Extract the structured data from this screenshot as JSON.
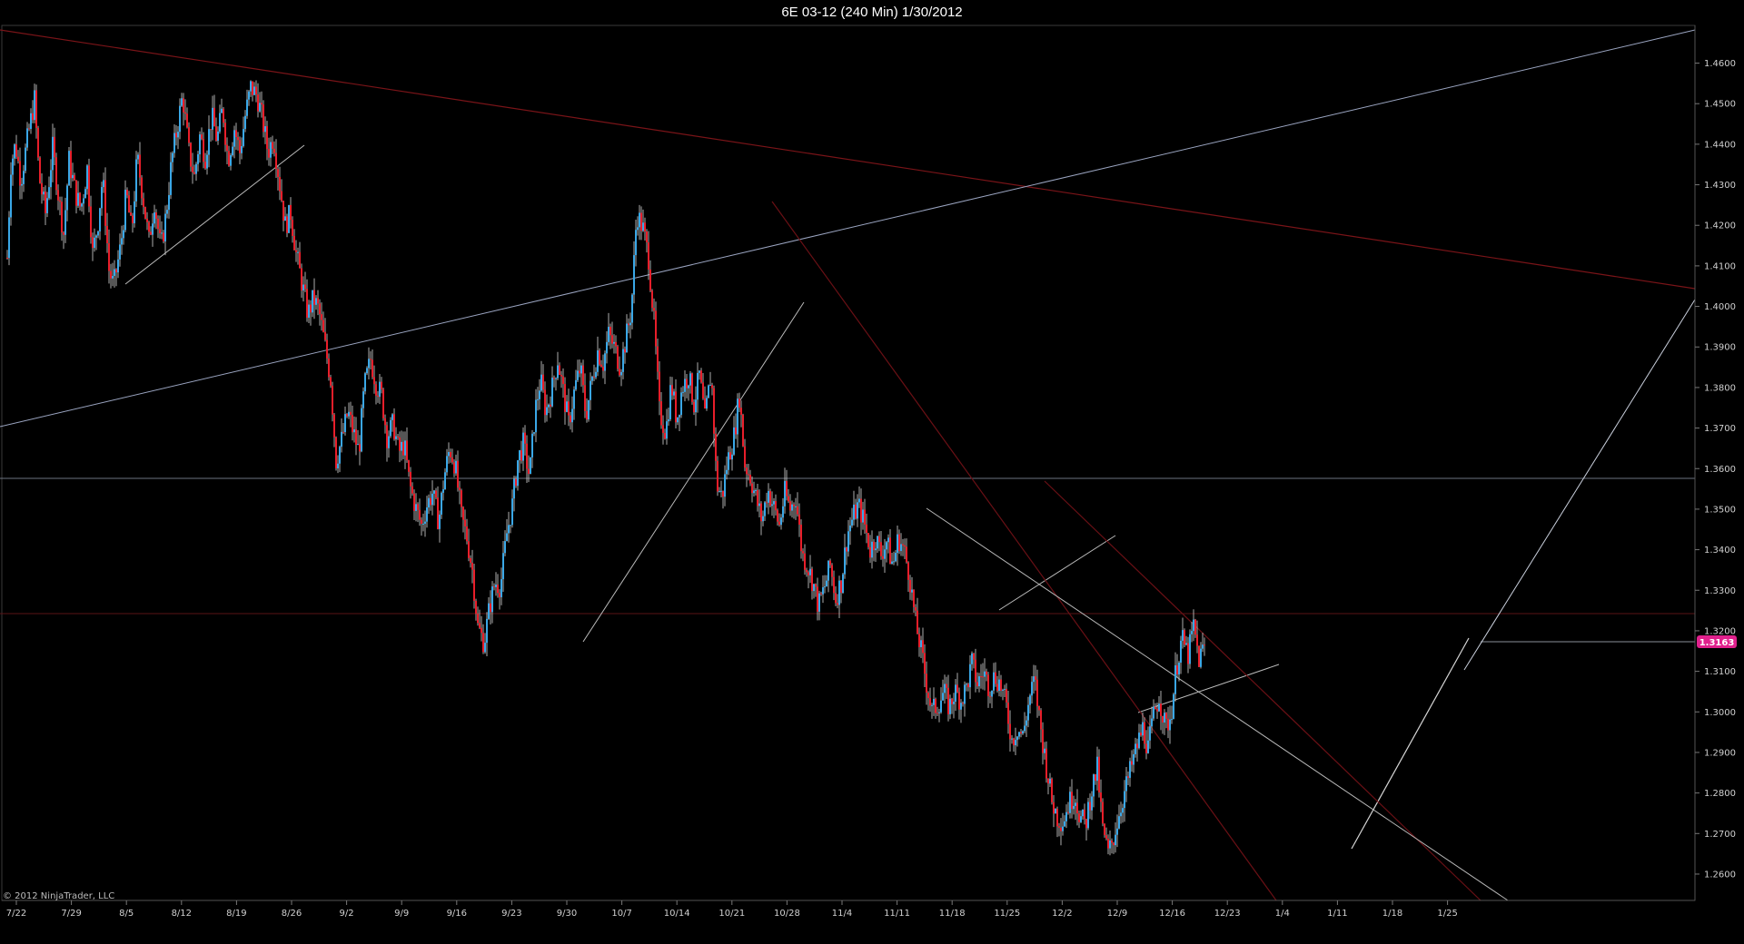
{
  "window": {
    "title": "6E 03-12 (240 Min)  1/30/2012"
  },
  "copyright": "© 2012 NinjaTrader, LLC",
  "colors": {
    "background": "#000000",
    "up_candle": "#3aa7e6",
    "down_candle": "#e81e2a",
    "wick": "#d8d8d8",
    "price_marker": "#e0208c",
    "axis": "#555555",
    "support_line": "#cfd6e8",
    "resistance_line": "#7a1418",
    "horizontal_level": "#8a9099"
  },
  "chart_data": {
    "type": "candlestick",
    "instrument": "6E 03-12",
    "timeframe": "240 Min",
    "date": "1/30/2012",
    "last_price": "1.3163",
    "ylim": [
      1.2535,
      1.4693
    ],
    "x_tick_labels": [
      "7/22",
      "7/29",
      "8/5",
      "8/12",
      "8/19",
      "8/26",
      "9/2",
      "9/9",
      "9/16",
      "9/23",
      "9/30",
      "10/7",
      "10/14",
      "10/21",
      "10/28",
      "11/4",
      "11/11",
      "11/18",
      "11/25",
      "12/2",
      "12/9",
      "12/16",
      "12/23",
      "1/4",
      "1/11",
      "1/18",
      "1/25"
    ],
    "y_tick_labels": [
      "1.4600",
      "1.4500",
      "1.4400",
      "1.4300",
      "1.4200",
      "1.4100",
      "1.4000",
      "1.3900",
      "1.3800",
      "1.3700",
      "1.3600",
      "1.3500",
      "1.3400",
      "1.3300",
      "1.3200",
      "1.3100",
      "1.3000",
      "1.2900",
      "1.2800",
      "1.2700",
      "1.2600"
    ],
    "price_path": [
      [
        0,
        1.412
      ],
      [
        4,
        1.435
      ],
      [
        9,
        1.44
      ],
      [
        15,
        1.431
      ],
      [
        22,
        1.441
      ],
      [
        30,
        1.451
      ],
      [
        35,
        1.432
      ],
      [
        42,
        1.423
      ],
      [
        50,
        1.439
      ],
      [
        57,
        1.426
      ],
      [
        62,
        1.418
      ],
      [
        68,
        1.436
      ],
      [
        75,
        1.428
      ],
      [
        81,
        1.424
      ],
      [
        88,
        1.434
      ],
      [
        94,
        1.413
      ],
      [
        100,
        1.421
      ],
      [
        105,
        1.432
      ],
      [
        112,
        1.409
      ],
      [
        117,
        1.405
      ],
      [
        125,
        1.415
      ],
      [
        131,
        1.428
      ],
      [
        137,
        1.418
      ],
      [
        143,
        1.437
      ],
      [
        150,
        1.426
      ],
      [
        156,
        1.416
      ],
      [
        162,
        1.426
      ],
      [
        169,
        1.414
      ],
      [
        175,
        1.423
      ],
      [
        181,
        1.436
      ],
      [
        187,
        1.444
      ],
      [
        193,
        1.452
      ],
      [
        200,
        1.438
      ],
      [
        206,
        1.432
      ],
      [
        212,
        1.442
      ],
      [
        218,
        1.437
      ],
      [
        225,
        1.447
      ],
      [
        231,
        1.441
      ],
      [
        237,
        1.449
      ],
      [
        243,
        1.436
      ],
      [
        250,
        1.444
      ],
      [
        256,
        1.438
      ],
      [
        262,
        1.447
      ],
      [
        268,
        1.454
      ],
      [
        275,
        1.452
      ],
      [
        281,
        1.446
      ],
      [
        287,
        1.438
      ],
      [
        293,
        1.442
      ],
      [
        300,
        1.43
      ],
      [
        306,
        1.42
      ],
      [
        312,
        1.423
      ],
      [
        318,
        1.413
      ],
      [
        325,
        1.405
      ],
      [
        331,
        1.398
      ],
      [
        337,
        1.402
      ],
      [
        343,
        1.399
      ],
      [
        350,
        1.39
      ],
      [
        356,
        1.382
      ],
      [
        362,
        1.362
      ],
      [
        368,
        1.367
      ],
      [
        375,
        1.374
      ],
      [
        381,
        1.369
      ],
      [
        387,
        1.364
      ],
      [
        393,
        1.38
      ],
      [
        400,
        1.387
      ],
      [
        406,
        1.381
      ],
      [
        412,
        1.378
      ],
      [
        418,
        1.368
      ],
      [
        425,
        1.371
      ],
      [
        431,
        1.364
      ],
      [
        437,
        1.366
      ],
      [
        443,
        1.356
      ],
      [
        450,
        1.35
      ],
      [
        456,
        1.346
      ],
      [
        462,
        1.351
      ],
      [
        468,
        1.354
      ],
      [
        475,
        1.347
      ],
      [
        481,
        1.358
      ],
      [
        487,
        1.365
      ],
      [
        493,
        1.361
      ],
      [
        500,
        1.348
      ],
      [
        506,
        1.343
      ],
      [
        512,
        1.335
      ],
      [
        518,
        1.321
      ],
      [
        525,
        1.317
      ],
      [
        531,
        1.326
      ],
      [
        537,
        1.332
      ],
      [
        543,
        1.331
      ],
      [
        550,
        1.344
      ],
      [
        556,
        1.351
      ],
      [
        562,
        1.362
      ],
      [
        568,
        1.366
      ],
      [
        575,
        1.358
      ],
      [
        581,
        1.374
      ],
      [
        587,
        1.382
      ],
      [
        593,
        1.374
      ],
      [
        600,
        1.38
      ],
      [
        606,
        1.387
      ],
      [
        612,
        1.379
      ],
      [
        618,
        1.371
      ],
      [
        625,
        1.38
      ],
      [
        631,
        1.385
      ],
      [
        637,
        1.373
      ],
      [
        643,
        1.381
      ],
      [
        650,
        1.389
      ],
      [
        656,
        1.386
      ],
      [
        662,
        1.393
      ],
      [
        668,
        1.39
      ],
      [
        675,
        1.385
      ],
      [
        681,
        1.392
      ],
      [
        687,
        1.399
      ],
      [
        693,
        1.423
      ],
      [
        700,
        1.419
      ],
      [
        706,
        1.412
      ],
      [
        712,
        1.396
      ],
      [
        718,
        1.374
      ],
      [
        725,
        1.369
      ],
      [
        731,
        1.381
      ],
      [
        737,
        1.372
      ],
      [
        743,
        1.38
      ],
      [
        750,
        1.383
      ],
      [
        756,
        1.376
      ],
      [
        762,
        1.383
      ],
      [
        768,
        1.372
      ],
      [
        775,
        1.384
      ],
      [
        781,
        1.356
      ],
      [
        787,
        1.353
      ],
      [
        793,
        1.362
      ],
      [
        800,
        1.368
      ],
      [
        806,
        1.378
      ],
      [
        812,
        1.361
      ],
      [
        818,
        1.358
      ],
      [
        825,
        1.352
      ],
      [
        831,
        1.347
      ],
      [
        837,
        1.355
      ],
      [
        843,
        1.351
      ],
      [
        850,
        1.346
      ],
      [
        856,
        1.354
      ],
      [
        862,
        1.35
      ],
      [
        868,
        1.353
      ],
      [
        875,
        1.339
      ],
      [
        881,
        1.336
      ],
      [
        887,
        1.332
      ],
      [
        893,
        1.326
      ],
      [
        900,
        1.331
      ],
      [
        906,
        1.336
      ],
      [
        912,
        1.328
      ],
      [
        918,
        1.332
      ],
      [
        925,
        1.344
      ],
      [
        931,
        1.348
      ],
      [
        937,
        1.351
      ],
      [
        943,
        1.347
      ],
      [
        950,
        1.34
      ],
      [
        956,
        1.343
      ],
      [
        962,
        1.339
      ],
      [
        968,
        1.342
      ],
      [
        975,
        1.336
      ],
      [
        981,
        1.343
      ],
      [
        987,
        1.34
      ],
      [
        993,
        1.334
      ],
      [
        1000,
        1.322
      ],
      [
        1006,
        1.315
      ],
      [
        1012,
        1.307
      ],
      [
        1018,
        1.3
      ],
      [
        1025,
        1.302
      ],
      [
        1031,
        1.305
      ],
      [
        1037,
        1.301
      ],
      [
        1043,
        1.305
      ],
      [
        1050,
        1.303
      ],
      [
        1056,
        1.306
      ],
      [
        1062,
        1.312
      ],
      [
        1068,
        1.307
      ],
      [
        1075,
        1.31
      ],
      [
        1081,
        1.306
      ],
      [
        1087,
        1.309
      ],
      [
        1093,
        1.307
      ],
      [
        1100,
        1.301
      ],
      [
        1106,
        1.293
      ],
      [
        1112,
        1.296
      ],
      [
        1118,
        1.294
      ],
      [
        1125,
        1.303
      ],
      [
        1131,
        1.308
      ],
      [
        1137,
        1.297
      ],
      [
        1143,
        1.288
      ],
      [
        1150,
        1.278
      ],
      [
        1156,
        1.274
      ],
      [
        1162,
        1.273
      ],
      [
        1168,
        1.277
      ],
      [
        1175,
        1.28
      ],
      [
        1181,
        1.274
      ],
      [
        1187,
        1.272
      ],
      [
        1193,
        1.28
      ],
      [
        1200,
        1.286
      ],
      [
        1206,
        1.271
      ],
      [
        1212,
        1.265
      ],
      [
        1218,
        1.269
      ],
      [
        1225,
        1.276
      ],
      [
        1231,
        1.281
      ],
      [
        1237,
        1.286
      ],
      [
        1243,
        1.291
      ],
      [
        1250,
        1.296
      ],
      [
        1256,
        1.291
      ],
      [
        1262,
        1.299
      ],
      [
        1268,
        1.304
      ],
      [
        1275,
        1.296
      ],
      [
        1281,
        1.299
      ],
      [
        1287,
        1.311
      ],
      [
        1293,
        1.318
      ],
      [
        1300,
        1.314
      ],
      [
        1306,
        1.321
      ],
      [
        1312,
        1.313
      ],
      [
        1318,
        1.3163
      ]
    ]
  }
}
